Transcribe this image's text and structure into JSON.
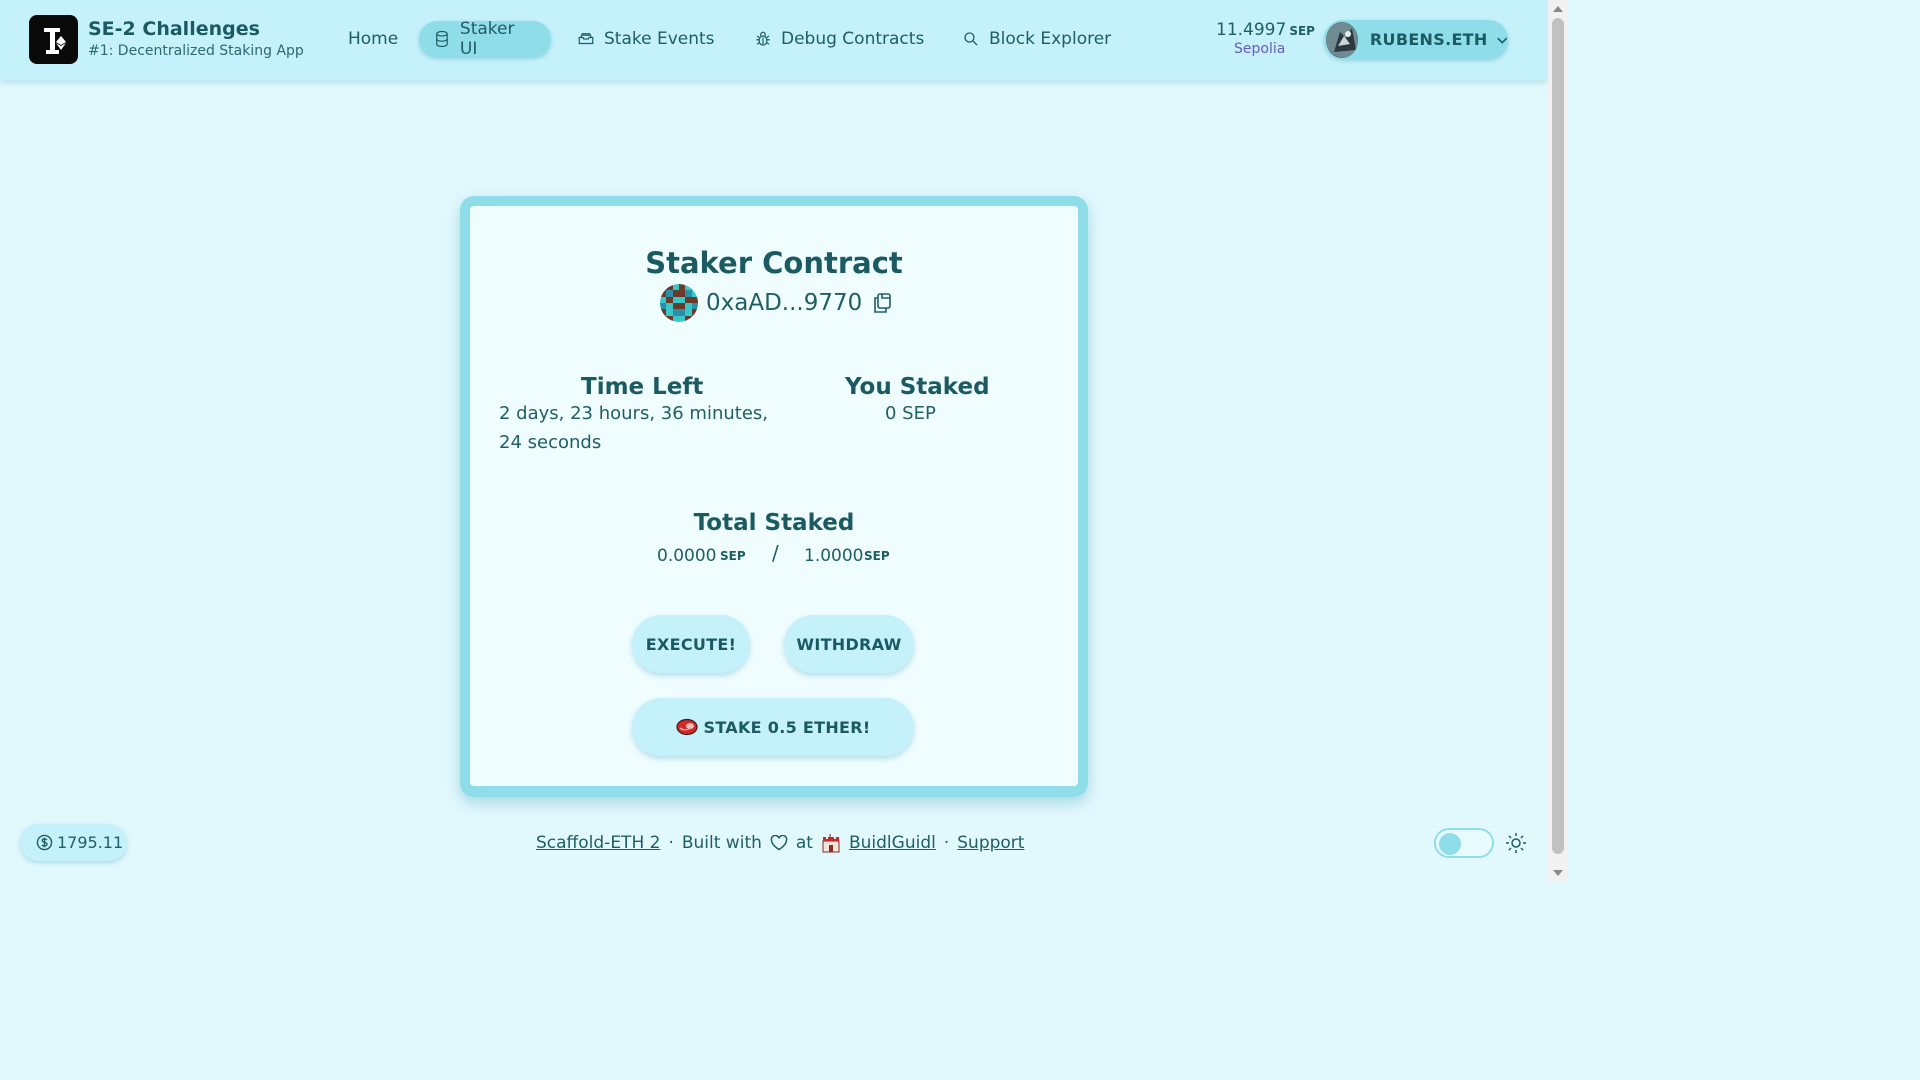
{
  "brand": {
    "title": "SE-2 Challenges",
    "subtitle": "#1: Decentralized Staking App"
  },
  "nav": {
    "items": [
      {
        "label": "Home",
        "icon": "",
        "active": false
      },
      {
        "label": "Staker UI",
        "icon": "database-icon",
        "active": true
      },
      {
        "label": "Stake Events",
        "icon": "inbox-stack-icon",
        "active": false
      },
      {
        "label": "Debug Contracts",
        "icon": "bug-icon",
        "active": false
      },
      {
        "label": "Block Explorer",
        "icon": "search-icon",
        "active": false
      }
    ]
  },
  "wallet": {
    "balance": "11.4997",
    "unit": "SEP",
    "network": "Sepolia",
    "account_name": "RUBENS.ETH"
  },
  "card": {
    "title": "Staker Contract",
    "address": "0xaAD...9770",
    "time_left_title": "Time Left",
    "time_left_line1": "2 days, 23 hours, 36 minutes,",
    "time_left_line2": "24 seconds",
    "you_staked_title": "You Staked",
    "you_staked_value": "0 SEP",
    "total_staked_title": "Total Staked",
    "total_staked": "0.0000",
    "total_unit": "SEP",
    "separator": "/",
    "threshold": "1.0000",
    "threshold_unit": "SEP",
    "execute_label": "EXECUTE!",
    "withdraw_label": "WITHDRAW",
    "stake_label": "STAKE 0.5 ETHER!"
  },
  "footer": {
    "eth_price": "1795.11",
    "scaffold_link": "Scaffold-ETH 2",
    "dot1": "·",
    "built_with": "Built with",
    "at": "at",
    "buidlguidl_link": "BuidlGuidl",
    "dot2": "·",
    "support_link": "Support"
  },
  "colors": {
    "background": "#e1f8fd",
    "header": "#c5f1fb",
    "accent": "#8fdde9",
    "text": "#1f5e63",
    "network": "#6b5bbf"
  }
}
